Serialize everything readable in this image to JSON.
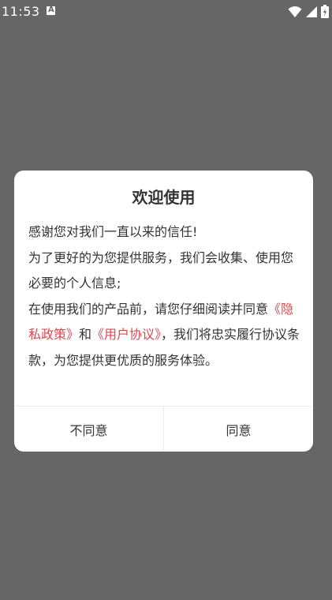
{
  "status_bar": {
    "time": "11:53",
    "icons": [
      "notification-a-icon",
      "wifi-icon",
      "signal-icon",
      "battery-icon"
    ]
  },
  "dialog": {
    "title": "欢迎使用",
    "line1": "感谢您对我们一直以来的信任!",
    "line2": "为了更好的为您提供服务，我们会收集、使用您必要的个人信息;",
    "line3_pre": "在使用我们的产品前，请您仔细阅读并同意",
    "privacy_link": "《隐私政策》",
    "and_text": "和",
    "agreement_link": "《用户协议》",
    "line3_post": "，我们将忠实履行协议条款，为您提供更优质的服务体验。",
    "disagree_label": "不同意",
    "agree_label": "同意"
  },
  "colors": {
    "overlay": "#666666",
    "link": "#e0474f",
    "text": "#333333"
  }
}
